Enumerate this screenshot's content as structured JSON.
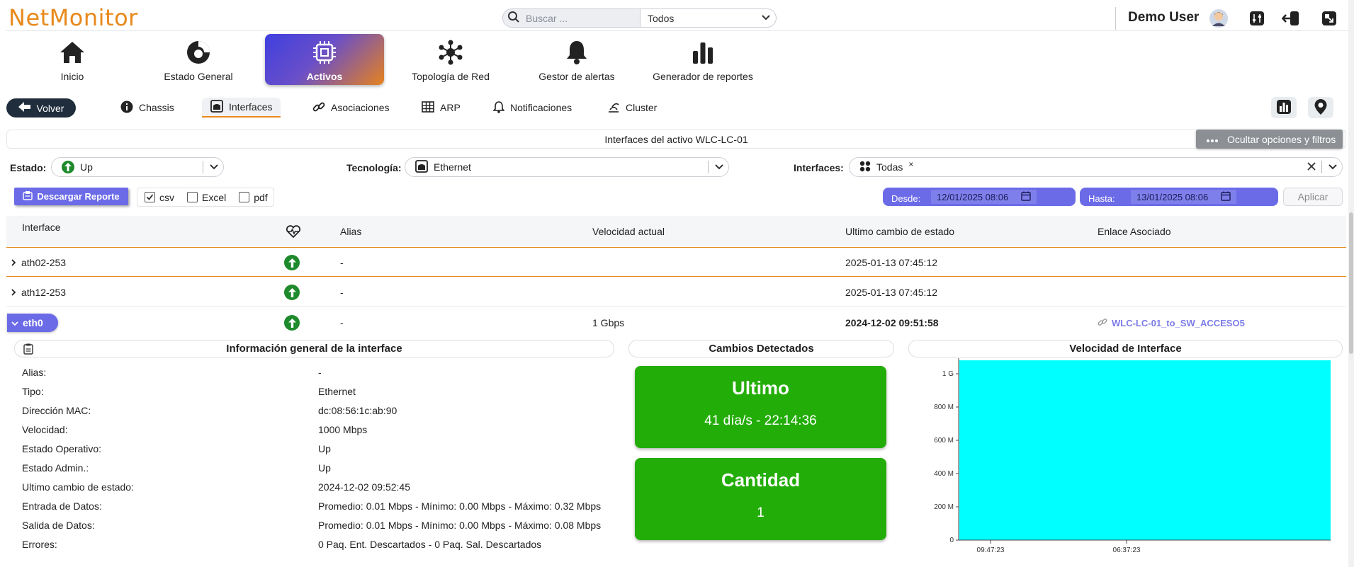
{
  "app": {
    "logo": "NetMonitor",
    "user": "Demo User"
  },
  "search": {
    "placeholder": "Buscar ...",
    "scope": "Todos"
  },
  "nav": [
    {
      "label": "Inicio",
      "icon": "home-icon"
    },
    {
      "label": "Estado General",
      "icon": "gauge-icon"
    },
    {
      "label": "Activos",
      "icon": "chip-icon",
      "active": true
    },
    {
      "label": "Topología de Red",
      "icon": "topology-icon"
    },
    {
      "label": "Gestor de alertas",
      "icon": "bell-icon"
    },
    {
      "label": "Generador de reportes",
      "icon": "bar-chart-icon"
    }
  ],
  "subtabs": {
    "back": "Volver",
    "items": [
      {
        "label": "Chassis",
        "icon": "info-icon"
      },
      {
        "label": "Interfaces",
        "icon": "interface-icon",
        "active": true
      },
      {
        "label": "Asociaciones",
        "icon": "link-icon"
      },
      {
        "label": "ARP",
        "icon": "table-icon"
      },
      {
        "label": "Notificaciones",
        "icon": "bell-icon"
      },
      {
        "label": "Cluster",
        "icon": "cluster-icon"
      }
    ]
  },
  "section": {
    "title": "Interfaces del activo WLC-LC-01",
    "toggle": "Ocultar opciones y filtros"
  },
  "filters": {
    "estado": {
      "label": "Estado:",
      "value": "Up"
    },
    "tecnologia": {
      "label": "Tecnología:",
      "value": "Ethernet"
    },
    "interfaces": {
      "label": "Interfaces:",
      "value": "Todas",
      "remove": "×"
    }
  },
  "report": {
    "download": "Descargar Reporte",
    "formats": [
      {
        "label": "csv",
        "checked": true
      },
      {
        "label": "Excel",
        "checked": false
      },
      {
        "label": "pdf",
        "checked": false
      }
    ],
    "desde": {
      "label": "Desde:",
      "value": "12/01/2025 08:06"
    },
    "hasta": {
      "label": "Hasta:",
      "value": "13/01/2025 08:06"
    },
    "apply": "Aplicar"
  },
  "table": {
    "headers": {
      "interface": "Interface",
      "alias": "Alias",
      "speed": "Velocidad actual",
      "last_change": "Ultimo cambio de estado",
      "link": "Enlace Asociado"
    },
    "rows": [
      {
        "name": "ath02-253",
        "alias": "-",
        "speed": "",
        "last_change": "2025-01-13 07:45:12",
        "link": ""
      },
      {
        "name": "ath12-253",
        "alias": "-",
        "speed": "",
        "last_change": "2025-01-13 07:45:12",
        "link": ""
      },
      {
        "name": "eth0",
        "alias": "-",
        "speed": "1 Gbps",
        "last_change": "2024-12-02 09:51:58",
        "link": "WLC-LC-01_to_SW_ACCESO5"
      }
    ]
  },
  "detail": {
    "info_title": "Información general de la interface",
    "changes_title": "Cambios Detectados",
    "speed_title": "Velocidad de Interface",
    "info": [
      {
        "k": "Alias:",
        "v": "-"
      },
      {
        "k": "Tipo:",
        "v": "Ethernet"
      },
      {
        "k": "Dirección MAC:",
        "v": "dc:08:56:1c:ab:90"
      },
      {
        "k": "Velocidad:",
        "v": "1000 Mbps"
      },
      {
        "k": "Estado Operativo:",
        "v": "Up"
      },
      {
        "k": "Estado Admin.:",
        "v": "Up"
      },
      {
        "k": "Ultimo cambio de estado:",
        "v": "2024-12-02 09:52:45"
      },
      {
        "k": "Entrada de Datos:",
        "v": "Promedio: 0.01 Mbps - Mínimo: 0.00 Mbps - Máximo: 0.32 Mbps"
      },
      {
        "k": "Salida de Datos:",
        "v": "Promedio: 0.01 Mbps - Mínimo: 0.00 Mbps - Máximo: 0.08 Mbps"
      },
      {
        "k": "Errores:",
        "v": "0 Paq. Ent. Descartados - 0 Paq. Sal. Descartados"
      }
    ],
    "cards": {
      "last": {
        "title": "Ultimo",
        "value": "41 día/s - 22:14:36"
      },
      "count": {
        "title": "Cantidad",
        "value": "1"
      }
    }
  },
  "colors": {
    "accent": "#e8891c",
    "primary": "#6b6be8",
    "up": "#1e8a2c",
    "card": "#23ad08",
    "area": "#00ffff"
  },
  "chart_data": {
    "type": "area",
    "y_ticks": [
      "0",
      "200 M",
      "400 M",
      "600 M",
      "800 M",
      "1 G"
    ],
    "x_ticks": [
      "09:47:23",
      "06:37:23"
    ],
    "ylim": [
      0,
      1000000000
    ],
    "series": [
      {
        "values": [
          1000000000,
          1000000000
        ]
      }
    ]
  }
}
